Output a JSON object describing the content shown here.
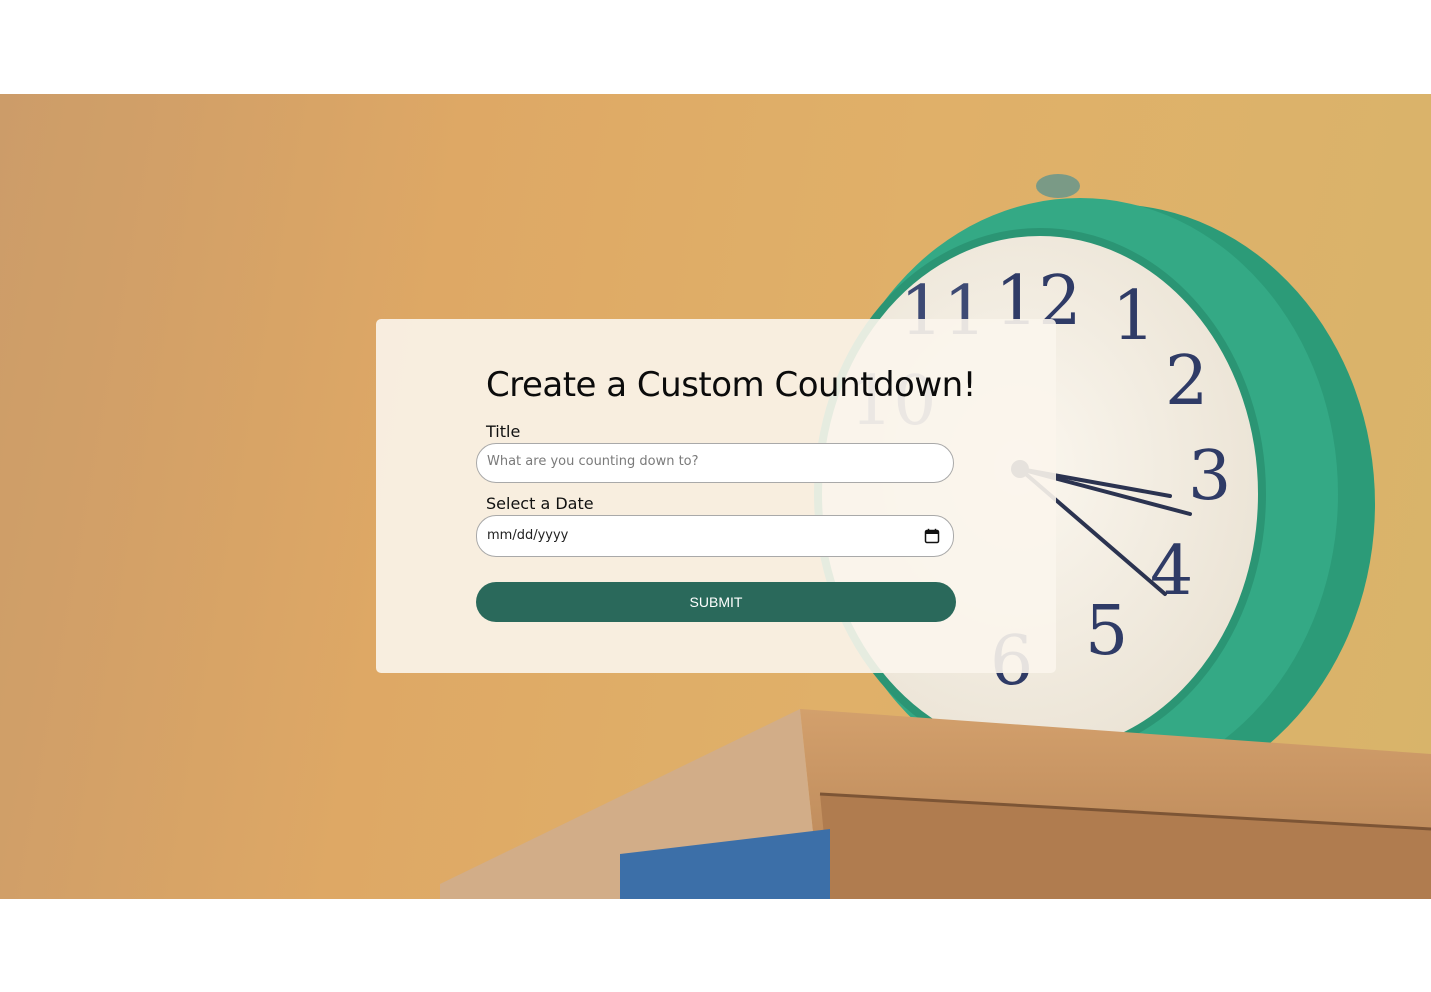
{
  "hero": {
    "background_image": "alarm-clock-on-books"
  },
  "form": {
    "heading": "Create a Custom Countdown!",
    "title_label": "Title",
    "title_placeholder": "What are you counting down to?",
    "title_value": "",
    "date_label": "Select a Date",
    "date_placeholder": "mm/dd/yyyy",
    "date_icon": "calendar-icon",
    "submit_label": "SUBMIT"
  },
  "colors": {
    "button": "#2a695b",
    "background_accent": "#dca35c",
    "clock_body": "#2a9a76"
  }
}
